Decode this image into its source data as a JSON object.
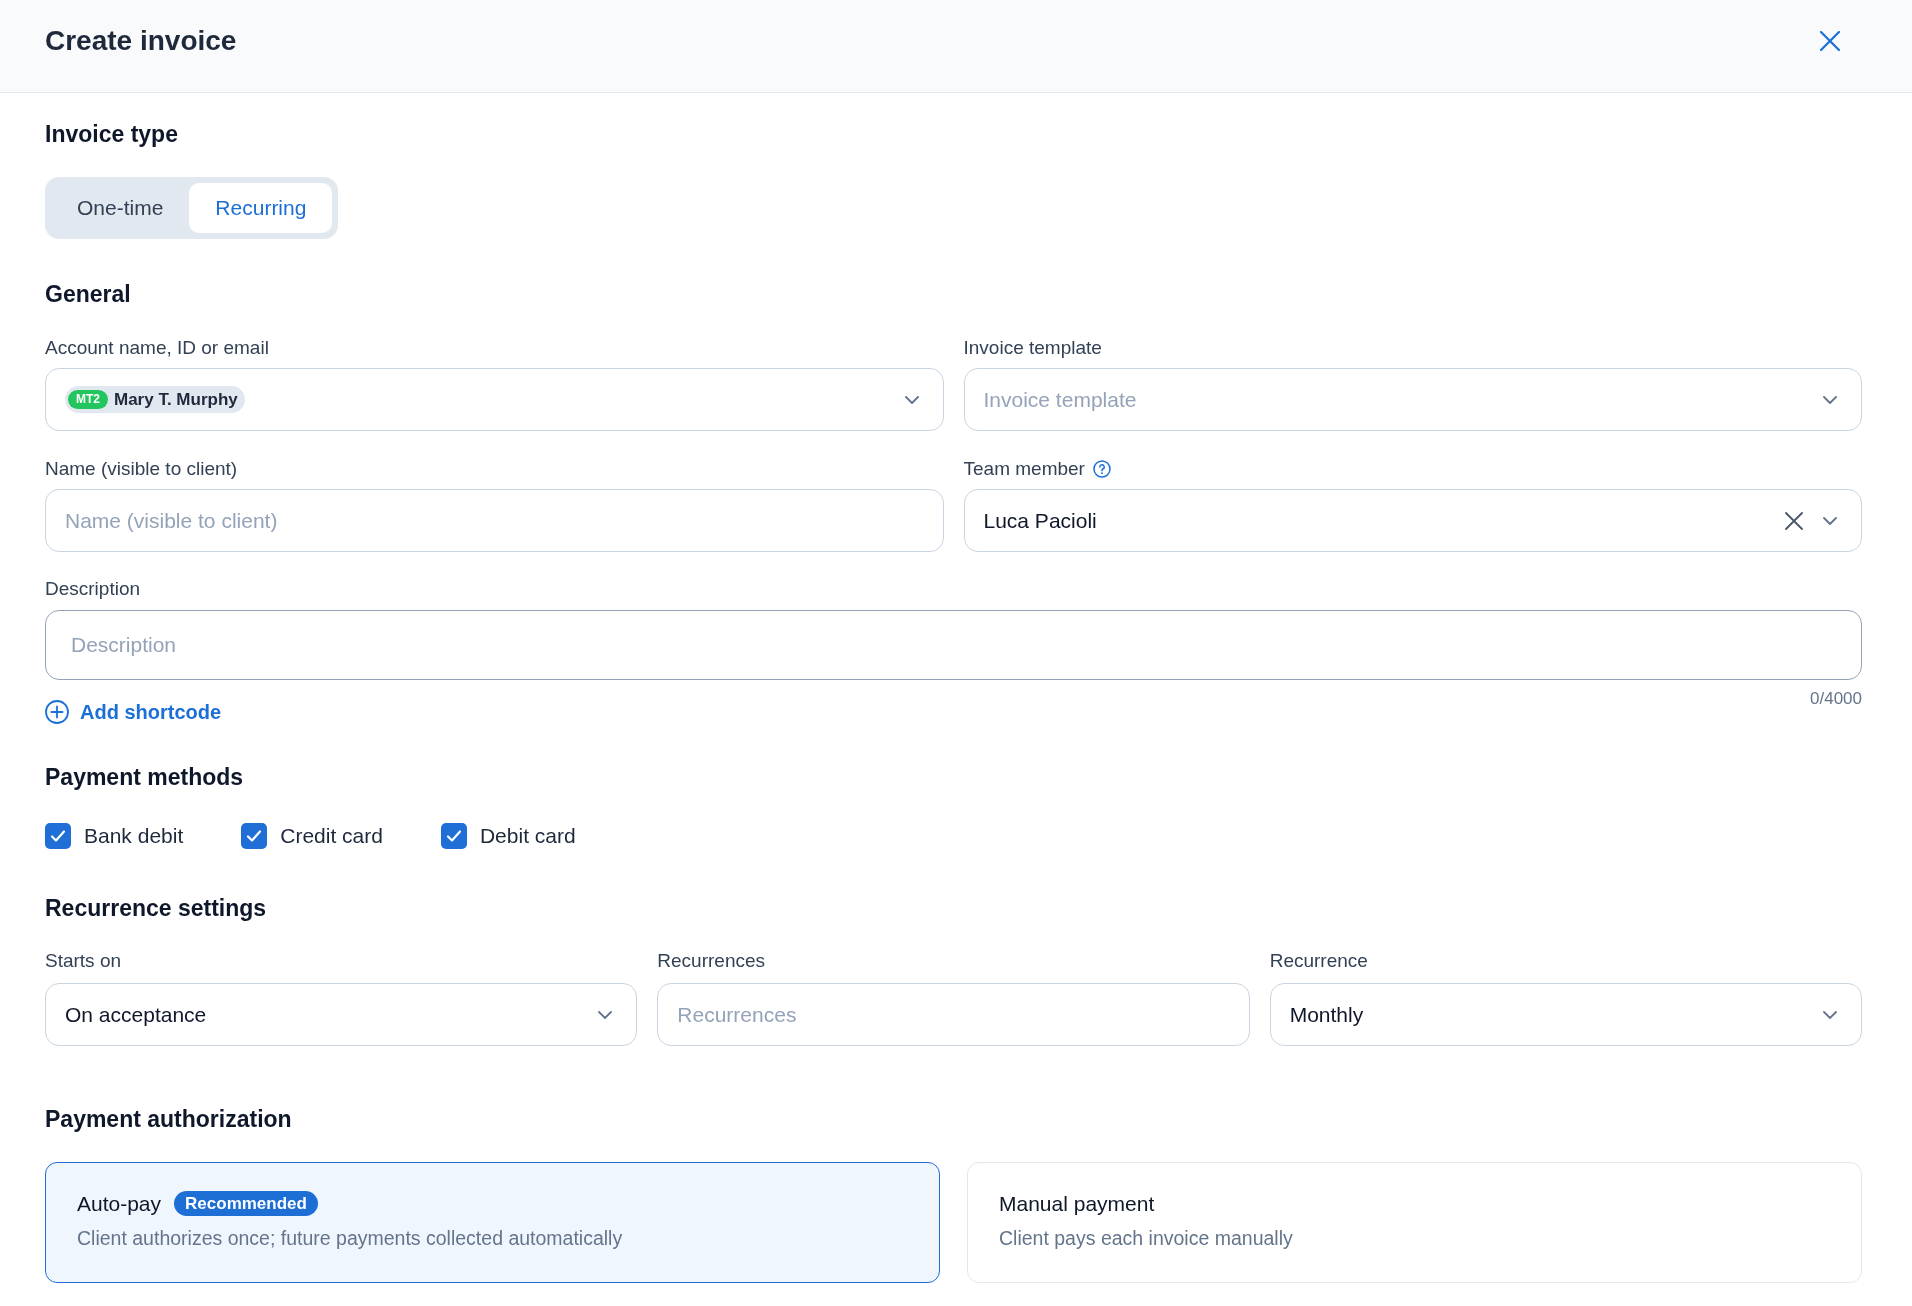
{
  "header": {
    "title": "Create invoice"
  },
  "invoice_type": {
    "heading": "Invoice type",
    "options": [
      {
        "label": "One-time",
        "selected": false
      },
      {
        "label": "Recurring",
        "selected": true
      }
    ]
  },
  "general": {
    "heading": "General",
    "fields": [
      {
        "label": "Account name, ID or email",
        "kind": "select",
        "chip": {
          "badge": "MT2",
          "name": "Mary T. Murphy"
        }
      },
      {
        "label": "Invoice template",
        "kind": "select",
        "placeholder": "Invoice template"
      },
      {
        "label": "Name (visible to client)",
        "kind": "text",
        "placeholder": "Name (visible to client)"
      },
      {
        "label": "Team member",
        "kind": "select",
        "value": "Luca Pacioli",
        "help": true,
        "clearable": true
      }
    ],
    "description": {
      "label": "Description",
      "placeholder": "Description",
      "counter": "0/4000"
    },
    "add_shortcode": "Add shortcode"
  },
  "payment_methods": {
    "heading": "Payment methods",
    "options": [
      {
        "label": "Bank debit",
        "checked": true
      },
      {
        "label": "Credit card",
        "checked": true
      },
      {
        "label": "Debit card",
        "checked": true
      }
    ]
  },
  "recurrence_settings": {
    "heading": "Recurrence settings",
    "fields": [
      {
        "label": "Starts on",
        "kind": "select",
        "value": "On acceptance"
      },
      {
        "label": "Recurrences",
        "kind": "text",
        "placeholder": "Recurrences"
      },
      {
        "label": "Recurrence",
        "kind": "select",
        "value": "Monthly"
      }
    ]
  },
  "payment_authorization": {
    "heading": "Payment authorization",
    "options": [
      {
        "title": "Auto-pay",
        "badge": "Recommended",
        "description": "Client authorizes once; future payments collected automatically",
        "selected": true
      },
      {
        "title": "Manual payment",
        "description": "Client pays each invoice manually",
        "selected": false
      }
    ]
  }
}
